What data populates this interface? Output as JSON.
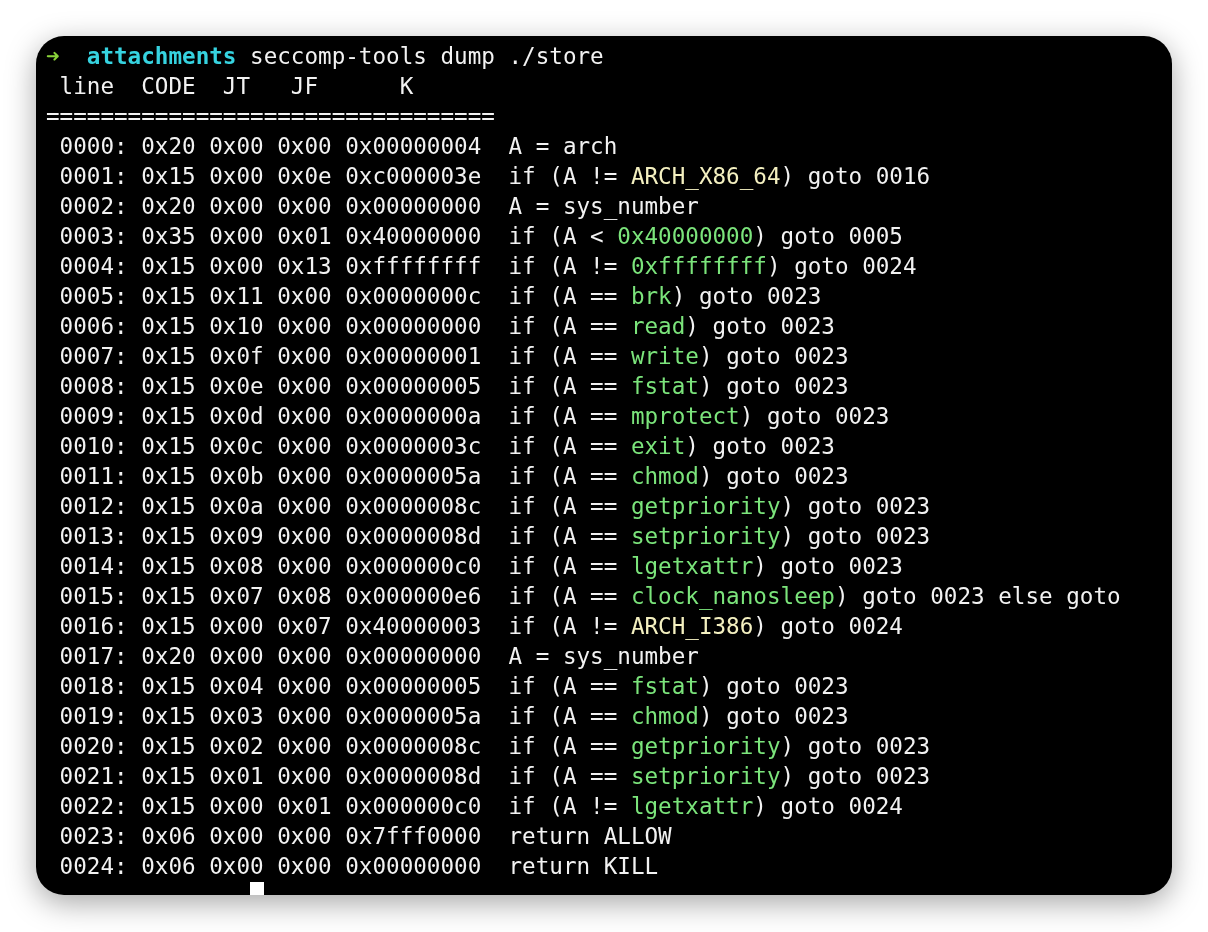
{
  "terminal": {
    "prompt": {
      "arrow": "➜",
      "directory": "attachments",
      "command": "seccomp-tools dump ./store"
    },
    "header": " line  CODE  JT   JF      K",
    "separator": "=================================",
    "rows": [
      {
        "line": "0000:",
        "code": "0x20",
        "jt": "0x00",
        "jf": "0x00",
        "k": "0x00000004",
        "statement": [
          {
            "kind": "plain",
            "text": "A = arch"
          }
        ]
      },
      {
        "line": "0001:",
        "code": "0x15",
        "jt": "0x00",
        "jf": "0x0e",
        "k": "0xc000003e",
        "statement": [
          {
            "kind": "plain",
            "text": "if (A != "
          },
          {
            "kind": "arch",
            "text": "ARCH_X86_64"
          },
          {
            "kind": "plain",
            "text": ") goto 0016"
          }
        ]
      },
      {
        "line": "0002:",
        "code": "0x20",
        "jt": "0x00",
        "jf": "0x00",
        "k": "0x00000000",
        "statement": [
          {
            "kind": "plain",
            "text": "A = sys_number"
          }
        ]
      },
      {
        "line": "0003:",
        "code": "0x35",
        "jt": "0x00",
        "jf": "0x01",
        "k": "0x40000000",
        "statement": [
          {
            "kind": "plain",
            "text": "if (A < "
          },
          {
            "kind": "value",
            "text": "0x40000000"
          },
          {
            "kind": "plain",
            "text": ") goto 0005"
          }
        ]
      },
      {
        "line": "0004:",
        "code": "0x15",
        "jt": "0x00",
        "jf": "0x13",
        "k": "0xffffffff",
        "statement": [
          {
            "kind": "plain",
            "text": "if (A != "
          },
          {
            "kind": "value",
            "text": "0xffffffff"
          },
          {
            "kind": "plain",
            "text": ") goto 0024"
          }
        ]
      },
      {
        "line": "0005:",
        "code": "0x15",
        "jt": "0x11",
        "jf": "0x00",
        "k": "0x0000000c",
        "statement": [
          {
            "kind": "plain",
            "text": "if (A == "
          },
          {
            "kind": "value",
            "text": "brk"
          },
          {
            "kind": "plain",
            "text": ") goto 0023"
          }
        ]
      },
      {
        "line": "0006:",
        "code": "0x15",
        "jt": "0x10",
        "jf": "0x00",
        "k": "0x00000000",
        "statement": [
          {
            "kind": "plain",
            "text": "if (A == "
          },
          {
            "kind": "value",
            "text": "read"
          },
          {
            "kind": "plain",
            "text": ") goto 0023"
          }
        ]
      },
      {
        "line": "0007:",
        "code": "0x15",
        "jt": "0x0f",
        "jf": "0x00",
        "k": "0x00000001",
        "statement": [
          {
            "kind": "plain",
            "text": "if (A == "
          },
          {
            "kind": "value",
            "text": "write"
          },
          {
            "kind": "plain",
            "text": ") goto 0023"
          }
        ]
      },
      {
        "line": "0008:",
        "code": "0x15",
        "jt": "0x0e",
        "jf": "0x00",
        "k": "0x00000005",
        "statement": [
          {
            "kind": "plain",
            "text": "if (A == "
          },
          {
            "kind": "value",
            "text": "fstat"
          },
          {
            "kind": "plain",
            "text": ") goto 0023"
          }
        ]
      },
      {
        "line": "0009:",
        "code": "0x15",
        "jt": "0x0d",
        "jf": "0x00",
        "k": "0x0000000a",
        "statement": [
          {
            "kind": "plain",
            "text": "if (A == "
          },
          {
            "kind": "value",
            "text": "mprotect"
          },
          {
            "kind": "plain",
            "text": ") goto 0023"
          }
        ]
      },
      {
        "line": "0010:",
        "code": "0x15",
        "jt": "0x0c",
        "jf": "0x00",
        "k": "0x0000003c",
        "statement": [
          {
            "kind": "plain",
            "text": "if (A == "
          },
          {
            "kind": "value",
            "text": "exit"
          },
          {
            "kind": "plain",
            "text": ") goto 0023"
          }
        ]
      },
      {
        "line": "0011:",
        "code": "0x15",
        "jt": "0x0b",
        "jf": "0x00",
        "k": "0x0000005a",
        "statement": [
          {
            "kind": "plain",
            "text": "if (A == "
          },
          {
            "kind": "value",
            "text": "chmod"
          },
          {
            "kind": "plain",
            "text": ") goto 0023"
          }
        ]
      },
      {
        "line": "0012:",
        "code": "0x15",
        "jt": "0x0a",
        "jf": "0x00",
        "k": "0x0000008c",
        "statement": [
          {
            "kind": "plain",
            "text": "if (A == "
          },
          {
            "kind": "value",
            "text": "getpriority"
          },
          {
            "kind": "plain",
            "text": ") goto 0023"
          }
        ]
      },
      {
        "line": "0013:",
        "code": "0x15",
        "jt": "0x09",
        "jf": "0x00",
        "k": "0x0000008d",
        "statement": [
          {
            "kind": "plain",
            "text": "if (A == "
          },
          {
            "kind": "value",
            "text": "setpriority"
          },
          {
            "kind": "plain",
            "text": ") goto 0023"
          }
        ]
      },
      {
        "line": "0014:",
        "code": "0x15",
        "jt": "0x08",
        "jf": "0x00",
        "k": "0x000000c0",
        "statement": [
          {
            "kind": "plain",
            "text": "if (A == "
          },
          {
            "kind": "value",
            "text": "lgetxattr"
          },
          {
            "kind": "plain",
            "text": ") goto 0023"
          }
        ]
      },
      {
        "line": "0015:",
        "code": "0x15",
        "jt": "0x07",
        "jf": "0x08",
        "k": "0x000000e6",
        "statement": [
          {
            "kind": "plain",
            "text": "if (A == "
          },
          {
            "kind": "value",
            "text": "clock_nanosleep"
          },
          {
            "kind": "plain",
            "text": ") goto 0023 else goto"
          }
        ]
      },
      {
        "line": "0016:",
        "code": "0x15",
        "jt": "0x00",
        "jf": "0x07",
        "k": "0x40000003",
        "statement": [
          {
            "kind": "plain",
            "text": "if (A != "
          },
          {
            "kind": "arch",
            "text": "ARCH_I386"
          },
          {
            "kind": "plain",
            "text": ") goto 0024"
          }
        ]
      },
      {
        "line": "0017:",
        "code": "0x20",
        "jt": "0x00",
        "jf": "0x00",
        "k": "0x00000000",
        "statement": [
          {
            "kind": "plain",
            "text": "A = sys_number"
          }
        ]
      },
      {
        "line": "0018:",
        "code": "0x15",
        "jt": "0x04",
        "jf": "0x00",
        "k": "0x00000005",
        "statement": [
          {
            "kind": "plain",
            "text": "if (A == "
          },
          {
            "kind": "value",
            "text": "fstat"
          },
          {
            "kind": "plain",
            "text": ") goto 0023"
          }
        ]
      },
      {
        "line": "0019:",
        "code": "0x15",
        "jt": "0x03",
        "jf": "0x00",
        "k": "0x0000005a",
        "statement": [
          {
            "kind": "plain",
            "text": "if (A == "
          },
          {
            "kind": "value",
            "text": "chmod"
          },
          {
            "kind": "plain",
            "text": ") goto 0023"
          }
        ]
      },
      {
        "line": "0020:",
        "code": "0x15",
        "jt": "0x02",
        "jf": "0x00",
        "k": "0x0000008c",
        "statement": [
          {
            "kind": "plain",
            "text": "if (A == "
          },
          {
            "kind": "value",
            "text": "getpriority"
          },
          {
            "kind": "plain",
            "text": ") goto 0023"
          }
        ]
      },
      {
        "line": "0021:",
        "code": "0x15",
        "jt": "0x01",
        "jf": "0x00",
        "k": "0x0000008d",
        "statement": [
          {
            "kind": "plain",
            "text": "if (A == "
          },
          {
            "kind": "value",
            "text": "setpriority"
          },
          {
            "kind": "plain",
            "text": ") goto 0023"
          }
        ]
      },
      {
        "line": "0022:",
        "code": "0x15",
        "jt": "0x00",
        "jf": "0x01",
        "k": "0x000000c0",
        "statement": [
          {
            "kind": "plain",
            "text": "if (A != "
          },
          {
            "kind": "value",
            "text": "lgetxattr"
          },
          {
            "kind": "plain",
            "text": ") goto 0024"
          }
        ]
      },
      {
        "line": "0023:",
        "code": "0x06",
        "jt": "0x00",
        "jf": "0x00",
        "k": "0x7fff0000",
        "statement": [
          {
            "kind": "plain",
            "text": "return ALLOW"
          }
        ]
      },
      {
        "line": "0024:",
        "code": "0x06",
        "jt": "0x00",
        "jf": "0x00",
        "k": "0x00000000",
        "statement": [
          {
            "kind": "plain",
            "text": "return KILL"
          }
        ]
      }
    ]
  }
}
